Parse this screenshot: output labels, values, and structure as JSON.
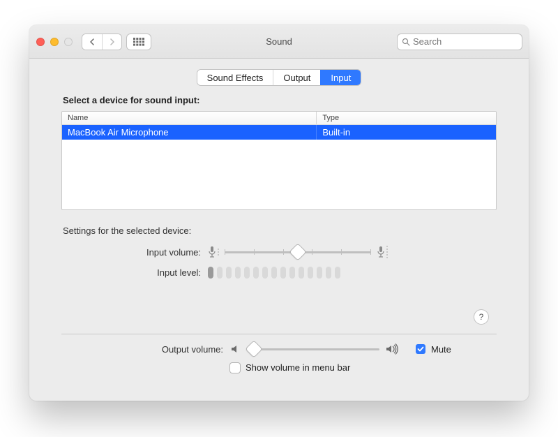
{
  "window": {
    "title": "Sound"
  },
  "search": {
    "placeholder": "Search",
    "value": ""
  },
  "tabs": {
    "sound_effects": "Sound Effects",
    "output": "Output",
    "input": "Input",
    "active": "input"
  },
  "select_heading": "Select a device for sound input:",
  "columns": {
    "name": "Name",
    "type": "Type"
  },
  "devices": [
    {
      "name": "MacBook Air Microphone",
      "type": "Built-in",
      "selected": true
    }
  ],
  "settings_heading": "Settings for the selected device:",
  "labels": {
    "input_volume": "Input volume:",
    "input_level": "Input level:",
    "output_volume": "Output volume:",
    "mute": "Mute",
    "show_in_menu_bar": "Show volume in menu bar"
  },
  "input_volume_percent": 50,
  "input_level_on_segments": 1,
  "input_level_total_segments": 15,
  "output_volume_percent": 5,
  "mute_checked": true,
  "show_in_menu_bar_checked": false,
  "help_label": "?",
  "colors": {
    "accent": "#2f79ff",
    "row_highlight": "#1a62ff"
  }
}
